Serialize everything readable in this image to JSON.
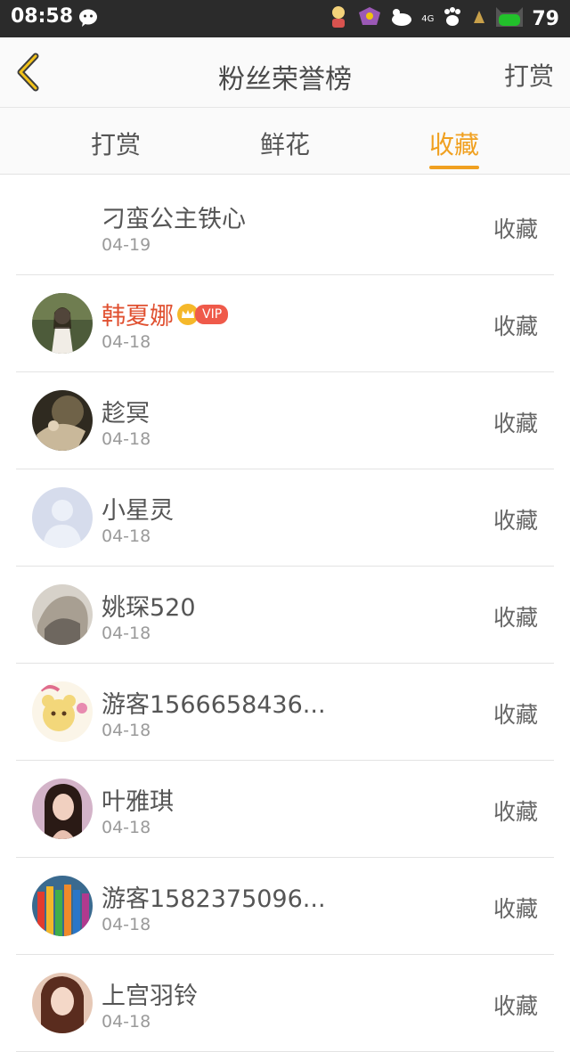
{
  "status_bar": {
    "time": "08:58",
    "network": "4G",
    "battery": "79",
    "icons": [
      "wechat-icon",
      "app-notification-icon",
      "app-notification-icon",
      "mouse-icon",
      "paw-icon",
      "app-notification-icon",
      "battery-icon"
    ]
  },
  "header": {
    "title": "粉丝荣誉榜",
    "right_action": "打赏",
    "back_icon": "chevron-left-icon"
  },
  "tabs": [
    {
      "label": "打赏",
      "active": false
    },
    {
      "label": "鲜花",
      "active": false
    },
    {
      "label": "收藏",
      "active": true
    }
  ],
  "colors": {
    "accent": "#f0a020",
    "vip_name": "#e05030",
    "status_bar_bg": "#2b2b2b",
    "battery": "#22c12b"
  },
  "list": [
    {
      "name": "刁蛮公主铁心",
      "date": "04-19",
      "action": "收藏",
      "avatar": "none"
    },
    {
      "name": "韩夏娜",
      "date": "04-18",
      "action": "收藏",
      "vip": true,
      "vip_label": "VIP",
      "avatar": "photo-avatar"
    },
    {
      "name": "趁冥",
      "date": "04-18",
      "action": "收藏",
      "avatar": "photo-avatar"
    },
    {
      "name": "小星灵",
      "date": "04-18",
      "action": "收藏",
      "avatar": "default-user-avatar"
    },
    {
      "name": "姚琛520",
      "date": "04-18",
      "action": "收藏",
      "avatar": "photo-avatar"
    },
    {
      "name": "游客1566658436...",
      "date": "04-18",
      "action": "收藏",
      "avatar": "cartoon-avatar"
    },
    {
      "name": "叶雅琪",
      "date": "04-18",
      "action": "收藏",
      "avatar": "photo-avatar"
    },
    {
      "name": "游客1582375096...",
      "date": "04-18",
      "action": "收藏",
      "avatar": "pencils-avatar"
    },
    {
      "name": "上宫羽铃",
      "date": "04-18",
      "action": "收藏",
      "avatar": "photo-avatar"
    }
  ]
}
